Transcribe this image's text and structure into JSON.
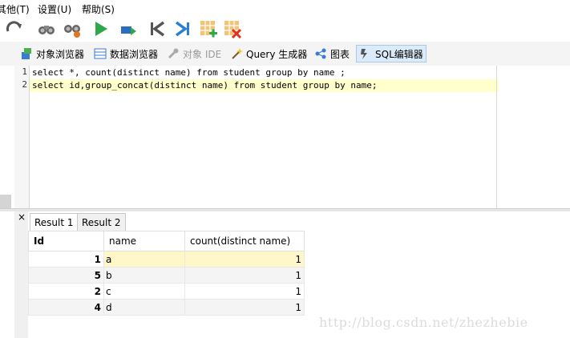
{
  "menu": {
    "items": [
      "其他(T)",
      "设置(U)",
      "帮助(S)"
    ]
  },
  "toolbar": {
    "icons": [
      "refresh-icon",
      "binoculars-icon",
      "binoculars-gear-icon",
      "run-icon",
      "step-icon",
      "first-icon",
      "last-icon",
      "add-row-icon",
      "delete-row-icon"
    ]
  },
  "tabs": [
    {
      "label": "对象浏览器",
      "icon": "object-browser-icon"
    },
    {
      "label": "数据浏览器",
      "icon": "data-browser-icon"
    },
    {
      "label": "对象 IDE",
      "icon": "wrench-icon"
    },
    {
      "label": "Query 生成器",
      "icon": "wand-icon"
    },
    {
      "label": "图表",
      "icon": "chart-icon"
    },
    {
      "label": "SQL编辑器",
      "icon": "sql-editor-icon"
    }
  ],
  "editor": {
    "lines": [
      {
        "num": "1",
        "code": "select *, count(distinct name) from student group by name ;"
      },
      {
        "num": "2",
        "code": "select id,group_concat(distinct name) from student group by name;"
      }
    ]
  },
  "results": {
    "close": "×",
    "tabs": [
      "Result 1",
      "Result 2"
    ],
    "columns": [
      "Id",
      "name",
      "count(distinct name)"
    ],
    "rows": [
      {
        "id": "1",
        "name": "a",
        "count": "1"
      },
      {
        "id": "5",
        "name": "b",
        "count": "1"
      },
      {
        "id": "2",
        "name": "c",
        "count": "1"
      },
      {
        "id": "4",
        "name": "d",
        "count": "1"
      }
    ]
  },
  "watermark": "http://blog.csdn.net/zhezhebie"
}
